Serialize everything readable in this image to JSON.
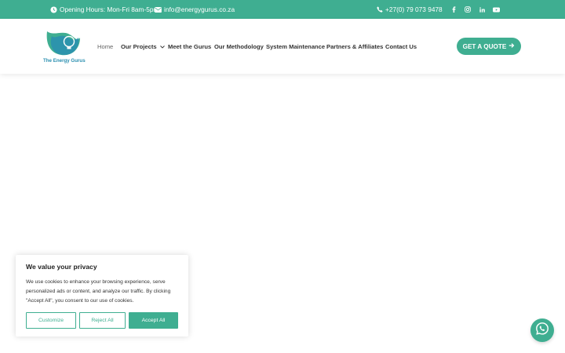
{
  "topbar": {
    "hours": "Opening Hours: Mon-Fri 8am-5pm",
    "email": "info@energygurus.co.za",
    "phone": "+27(0) 79 073 9478",
    "social": [
      "facebook-icon",
      "instagram-icon",
      "linkedin-icon",
      "youtube-icon"
    ]
  },
  "header": {
    "logo_text": "The Energy Gurus",
    "nav": [
      "Home",
      "Our Projects",
      "Meet the Gurus",
      "Our Methodology",
      "System Maintenance",
      "Partners & Affiliates",
      "Contact Us"
    ],
    "active_nav": "Home",
    "cta": "GET A QUOTE"
  },
  "cookie": {
    "title": "We value your privacy",
    "text": "We use cookies to enhance your browsing experience, serve personalized ads or content, and analyze our traffic. By clicking \"Accept All\", you consent to our use of cookies.",
    "customize": "Customize",
    "reject": "Reject All",
    "accept": "Accept All"
  },
  "colors": {
    "brand": "#3fae91",
    "logo_blue": "#2a8fb0"
  }
}
